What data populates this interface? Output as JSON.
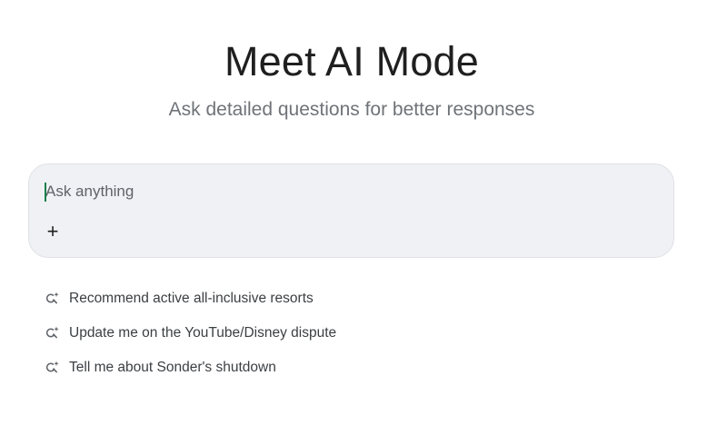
{
  "hero": {
    "title": "Meet AI Mode",
    "subtitle": "Ask detailed questions for better responses"
  },
  "prompt": {
    "placeholder": "Ask anything",
    "value": "",
    "add_label": "+"
  },
  "suggestions": [
    {
      "label": "Recommend active all-inclusive resorts",
      "icon": "search-sparkle-icon"
    },
    {
      "label": "Update me on the YouTube/Disney dispute",
      "icon": "search-sparkle-icon"
    },
    {
      "label": "Tell me about Sonder's shutdown",
      "icon": "search-sparkle-icon"
    }
  ],
  "colors": {
    "box_background": "#eff1f5",
    "caret": "#1a7f4b",
    "subtitle": "#6f7378"
  }
}
